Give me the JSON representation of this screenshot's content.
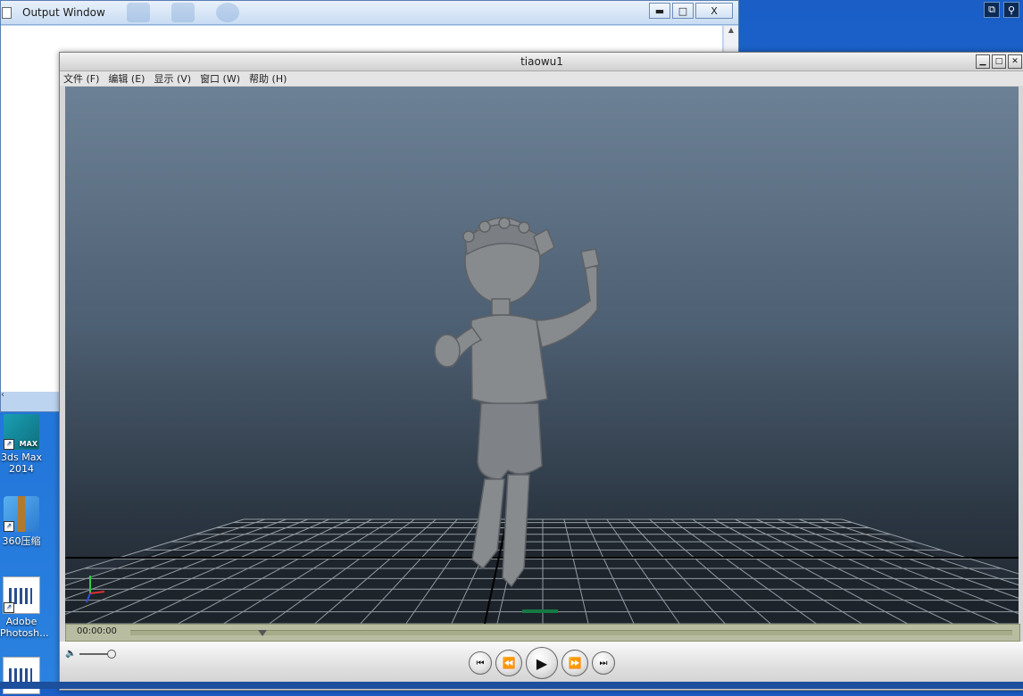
{
  "output_window": {
    "title": "Output Window",
    "controls": {
      "minimize": "▬",
      "maximize": "□",
      "close": "X"
    }
  },
  "desktop_icons": [
    {
      "label_line1": "3ds Max",
      "label_line2": "2014",
      "icon": "3dsmax-icon"
    },
    {
      "label_line1": "360压缩",
      "label_line2": "",
      "icon": "360zip-icon"
    },
    {
      "label_line1": "Adobe",
      "label_line2": "Photosh...",
      "icon": "document-icon"
    }
  ],
  "viewer": {
    "title": "tiaowu1",
    "menu": [
      "文件 (F)",
      "编辑 (E)",
      "显示 (V)",
      "窗口 (W)",
      "帮助 (H)"
    ],
    "timeline": {
      "time": "00:00:00",
      "progress": 0.15
    },
    "playback": {
      "prev": "⏮",
      "rewind": "⏪",
      "play": "▶",
      "forward": "⏩",
      "next": "⏭"
    },
    "volume": {
      "level": 1.0
    }
  },
  "colors": {
    "desktop_blue": "#1f6fd6",
    "viewport_top": "#6d8196",
    "viewport_bottom": "#1f262e",
    "character": "#8a8a8a",
    "timeline": "#b8bca0"
  }
}
